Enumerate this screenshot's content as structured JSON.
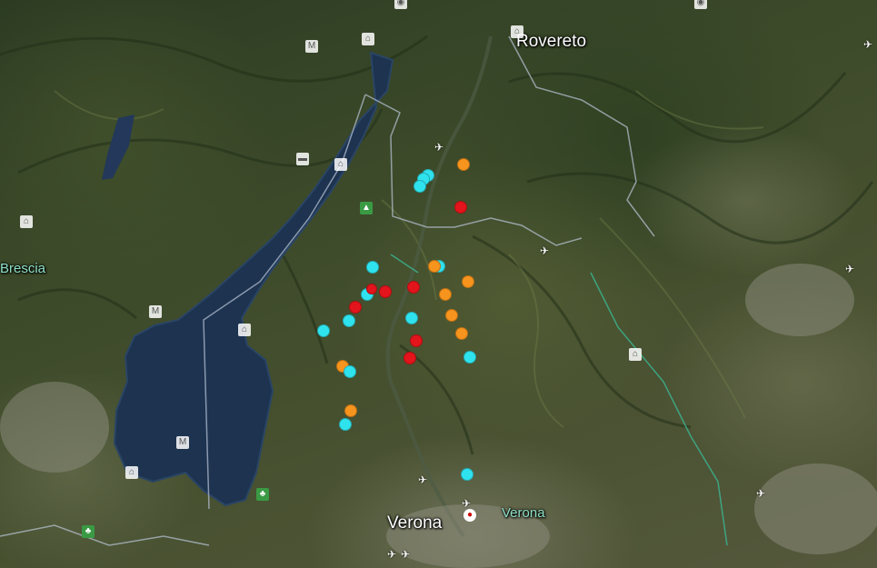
{
  "map": {
    "labels": [
      {
        "id": "rovereto",
        "text": "Rovereto",
        "kind": "city"
      },
      {
        "id": "verona-city",
        "text": "Verona",
        "kind": "city"
      },
      {
        "id": "verona-region",
        "text": "Verona",
        "kind": "region"
      },
      {
        "id": "brescia",
        "text": "Brescia",
        "kind": "region"
      }
    ],
    "marker_colors": {
      "orange": "#f7941d",
      "cyan": "#2fe3ee",
      "red": "#e3141b"
    },
    "marker_counts": {
      "orange": 10,
      "cyan": 14,
      "red": 8
    },
    "poi_icons": [
      "museum-icon",
      "monument-icon",
      "hotel-icon",
      "park-icon",
      "airport-icon",
      "camera-icon"
    ]
  }
}
